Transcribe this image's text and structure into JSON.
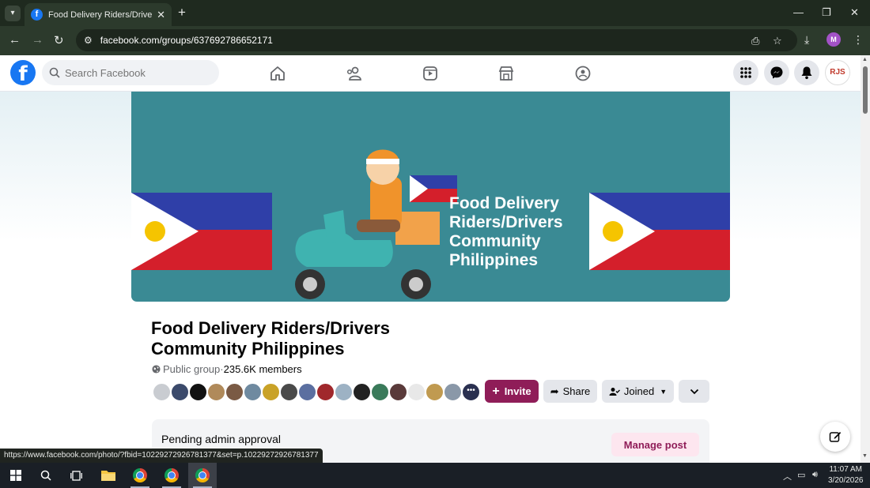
{
  "browser": {
    "tab_title": "Food Delivery Riders/Drivers Co",
    "url": "facebook.com/groups/637692786652171",
    "profile_initial": "M"
  },
  "fb": {
    "search_placeholder": "Search Facebook",
    "avatar_text": "RJS",
    "nav_items": [
      "home-icon",
      "friends-icon",
      "video-icon",
      "marketplace-icon",
      "groups-icon"
    ]
  },
  "group": {
    "cover_text": [
      "Food Delivery",
      "Riders/Drivers",
      "Community",
      "Philippines"
    ],
    "title_line1": "Food Delivery Riders/Drivers",
    "title_line2": "Community Philippines",
    "privacy": "Public group",
    "separator": " · ",
    "members": "235.6K members",
    "invite_label": "Invite",
    "share_label": "Share",
    "joined_label": "Joined"
  },
  "pending": {
    "label": "Pending admin approval",
    "manage_label": "Manage post"
  },
  "status_url": "https://www.facebook.com/photo/?fbid=10229272926781377&set=p.10229272926781377",
  "taskbar": {
    "time": "11:07 AM",
    "date": "3/20/2026"
  },
  "colors": {
    "brand": "#1877f2",
    "accent": "#8f1d58",
    "cover_bg": "#3a8a94"
  }
}
